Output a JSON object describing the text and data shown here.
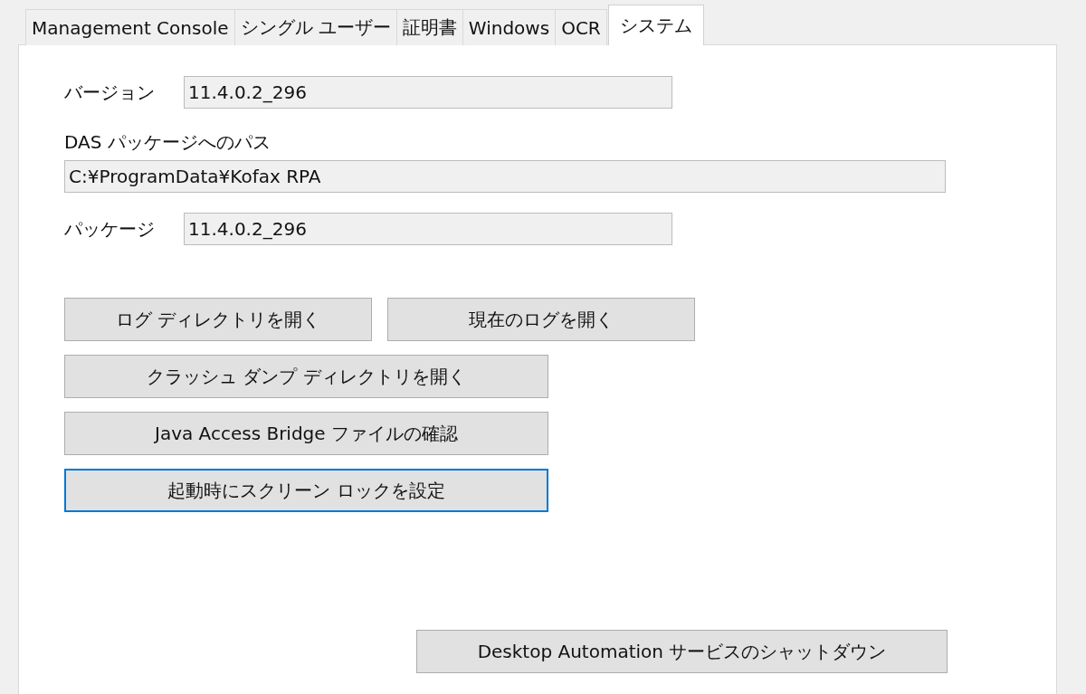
{
  "tabs": [
    {
      "label": "Management Console",
      "selected": false
    },
    {
      "label": "シングル ユーザー",
      "selected": false
    },
    {
      "label": "証明書",
      "selected": false
    },
    {
      "label": "Windows",
      "selected": false
    },
    {
      "label": "OCR",
      "selected": false
    },
    {
      "label": "システム",
      "selected": true
    }
  ],
  "fields": [
    {
      "kind": "inline",
      "label": "バージョン",
      "value": "11.4.0.2_296"
    },
    {
      "kind": "stacked",
      "label": "DAS パッケージへのパス",
      "value": "C:¥ProgramData¥Kofax RPA"
    },
    {
      "kind": "inline",
      "label": "パッケージ",
      "value": "11.4.0.2_296"
    }
  ],
  "button_rows": [
    [
      {
        "label": "ログ ディレクトリを開く",
        "focused": false
      },
      {
        "label": "現在のログを開く",
        "focused": false
      }
    ],
    [
      {
        "label": "クラッシュ ダンプ ディレクトリを開く",
        "focused": false
      }
    ],
    [
      {
        "label": "Java Access Bridge ファイルの確認",
        "focused": false
      }
    ],
    [
      {
        "label": "起動時にスクリーン ロックを設定",
        "focused": true
      }
    ]
  ],
  "shutdown_button": {
    "label": "Desktop Automation サービスのシャットダウン",
    "focused": false
  }
}
